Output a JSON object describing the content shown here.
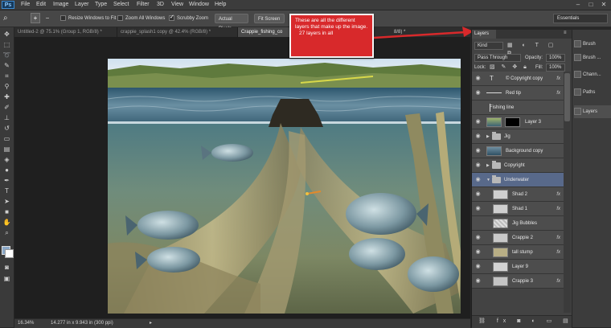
{
  "app": {
    "logo": "Ps"
  },
  "menu": [
    "File",
    "Edit",
    "Image",
    "Layer",
    "Type",
    "Select",
    "Filter",
    "3D",
    "View",
    "Window",
    "Help"
  ],
  "window_controls": [
    "–",
    "□",
    "✕"
  ],
  "options_bar": {
    "resize_windows": "Resize Windows to Fit",
    "zoom_all": "Zoom All Windows",
    "scrubby": "Scrubby Zoom",
    "actual_pixels": "Actual Pixels",
    "fit_screen": "Fit Screen",
    "workspace": "Essentials"
  },
  "tabs": [
    "Untitled-2 @ 75.1% (Group 1, RGB/8) *",
    "crappie_splash1 copy @ 42.4% (RGB/8) *",
    "Crappie_fishing_co"
  ],
  "tabs_tail": "8/8) *",
  "callout": {
    "text1": "These are all the different layers that make up the image.",
    "text2": "27 layers in all"
  },
  "status": {
    "zoom": "16.34%",
    "doc_size": "14.277 in x 9.943 in (300 ppi)"
  },
  "layers_panel": {
    "title": "Layers",
    "kind": "Kind",
    "blend_mode": "Pass Through",
    "opacity_label": "Opacity:",
    "opacity": "100%",
    "lock_label": "Lock:",
    "fill_label": "Fill:",
    "fill": "100%",
    "layers": [
      {
        "name": "© Copyright copy",
        "kind": "text",
        "fx": true
      },
      {
        "name": "Red tip",
        "kind": "shape",
        "fx": true
      },
      {
        "name": "Fishing line",
        "kind": "plain",
        "fx": false
      },
      {
        "name": "Layer 3",
        "kind": "masked",
        "fx": false
      },
      {
        "name": "Jig",
        "kind": "group",
        "fx": false
      },
      {
        "name": "Background copy",
        "kind": "image",
        "fx": false
      },
      {
        "name": "Copyright",
        "kind": "group",
        "fx": false
      },
      {
        "name": "Underwater",
        "kind": "group-open",
        "fx": false,
        "selected": true
      },
      {
        "name": "Shad 2",
        "kind": "image",
        "fx": true
      },
      {
        "name": "Shad 1",
        "kind": "image",
        "fx": true
      },
      {
        "name": "Jig Bubbles",
        "kind": "image",
        "fx": false
      },
      {
        "name": "Crappie 2",
        "kind": "image",
        "fx": true
      },
      {
        "name": "tall stump",
        "kind": "image",
        "fx": true
      },
      {
        "name": "Layer 9",
        "kind": "image",
        "fx": false
      },
      {
        "name": "Crappie 3",
        "kind": "image",
        "fx": true
      }
    ]
  },
  "dock": [
    "Brush",
    "Brush ...",
    "Chann...",
    "Paths",
    "Layers"
  ]
}
